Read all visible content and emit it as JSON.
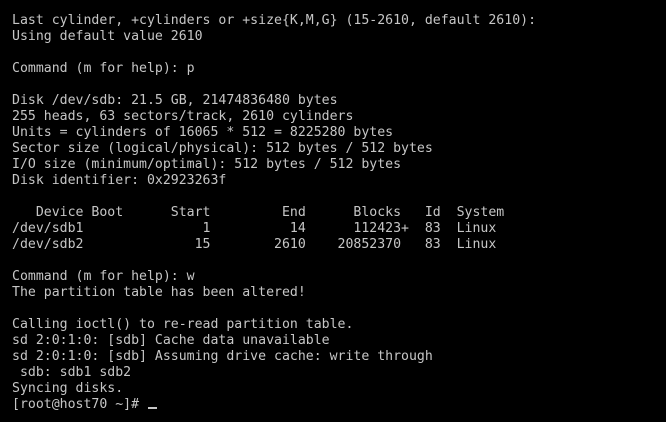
{
  "terminal": {
    "lines": [
      "Last cylinder, +cylinders or +size{K,M,G} (15-2610, default 2610):",
      "Using default value 2610",
      "",
      "Command (m for help): p",
      "",
      "Disk /dev/sdb: 21.5 GB, 21474836480 bytes",
      "255 heads, 63 sectors/track, 2610 cylinders",
      "Units = cylinders of 16065 * 512 = 8225280 bytes",
      "Sector size (logical/physical): 512 bytes / 512 bytes",
      "I/O size (minimum/optimal): 512 bytes / 512 bytes",
      "Disk identifier: 0x2923263f",
      "",
      "   Device Boot      Start         End      Blocks   Id  System",
      "/dev/sdb1               1          14      112423+  83  Linux",
      "/dev/sdb2              15        2610    20852370   83  Linux",
      "",
      "Command (m for help): w",
      "The partition table has been altered!",
      "",
      "Calling ioctl() to re-read partition table.",
      "sd 2:0:1:0: [sdb] Cache data unavailable",
      "sd 2:0:1:0: [sdb] Assuming drive cache: write through",
      " sdb: sdb1 sdb2",
      "Syncing disks."
    ],
    "prompt": "[root@host70 ~]# "
  }
}
